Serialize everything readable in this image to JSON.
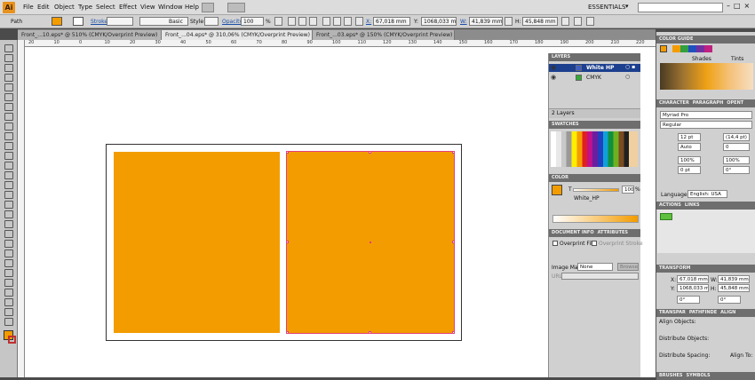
{
  "app": {
    "logo": "Ai"
  },
  "menu": [
    "File",
    "Edit",
    "Object",
    "Type",
    "Select",
    "Effect",
    "View",
    "Window",
    "Help"
  ],
  "workspace": "ESSENTIALS",
  "control": {
    "selection": "Path",
    "stroke_label": "Stroke:",
    "brush": "Basic",
    "style_label": "Style:",
    "opacity_label": "Opacity:",
    "opacity": "100",
    "percent": "%",
    "x_label": "X:",
    "x": "67,018 mm",
    "y_label": "Y:",
    "y": "1068,033 m",
    "w_label": "W:",
    "w": "41,839 mm",
    "h_label": "H:",
    "h": "45,848 mm"
  },
  "tabs": [
    {
      "label": "Front_...10.eps* @ 510% (CMYK/Overprint Preview)"
    },
    {
      "label": "Front_...04.eps* @ 310,06% (CMYK/Overprint Preview)"
    },
    {
      "label": "Front_...03.eps* @ 150% (CMYK/Overprint Preview)"
    }
  ],
  "ruler_numbers": [
    "20",
    "10",
    "0",
    "10",
    "20",
    "30",
    "40",
    "50",
    "60",
    "70",
    "80",
    "90",
    "100",
    "110",
    "120",
    "130",
    "140",
    "150",
    "160",
    "170",
    "180",
    "190",
    "200",
    "210",
    "220"
  ],
  "layers": {
    "title": "LAYERS",
    "items": [
      {
        "name": "White HP",
        "color": "#3a5fcc"
      },
      {
        "name": "CMYK",
        "color": "#33aa33"
      }
    ],
    "footer": "2 Layers"
  },
  "swatches": {
    "title": "SWATCHES"
  },
  "color_panel": {
    "title": "COLOR",
    "t_label": "T",
    "value": "100",
    "percent": "%",
    "name": "White_HP"
  },
  "document_info": {
    "tab1": "DOCUMENT INFO",
    "tab2": "ATTRIBUTES",
    "overprint_fill": "Overprint Fill",
    "overprint_stroke": "Overprint Stroke",
    "image_map_label": "Image Map:",
    "image_map": "None",
    "browser_btn": "Browser...",
    "url_label": "URL:"
  },
  "color_guide": {
    "title": "COLOR GUIDE",
    "shades": "Shades",
    "tints": "Tints"
  },
  "character": {
    "tab1": "CHARACTER",
    "tab2": "PARAGRAPH",
    "tab3": "OPENT",
    "font": "Myriad Pro",
    "style": "Regular",
    "size": "12 pt",
    "leading": "(14,4 pt)",
    "kerning": "Auto",
    "tracking": "0",
    "hscale": "100%",
    "vscale": "100%",
    "baseline": "0 pt",
    "rotation": "0°",
    "language_label": "Language:",
    "language": "English: USA"
  },
  "actions": {
    "tab1": "ACTIONS",
    "tab2": "LINKS"
  },
  "transform": {
    "title": "TRANSFORM",
    "x_label": "X:",
    "x": "67,018 mm",
    "y_label": "Y:",
    "y": "1068,033 m",
    "w_label": "W:",
    "w": "41,839 mm",
    "h_label": "H:",
    "h": "45,848 mm",
    "angle1": "0°",
    "angle2": "0°"
  },
  "align": {
    "tab1": "TRANSPAR",
    "tab2": "PATHFINDE",
    "tab3": "ALIGN",
    "align_objects": "Align Objects:",
    "distribute_objects": "Distribute Objects:",
    "distribute_spacing": "Distribute Spacing:",
    "align_to": "Align To:"
  },
  "bottom_tabs": {
    "tab1": "BRUSHES",
    "tab2": "SYMBOLS"
  },
  "colors": {
    "orange": "#f39c00",
    "selection": "#e0407a",
    "panel_header": "#6e6e6e"
  }
}
